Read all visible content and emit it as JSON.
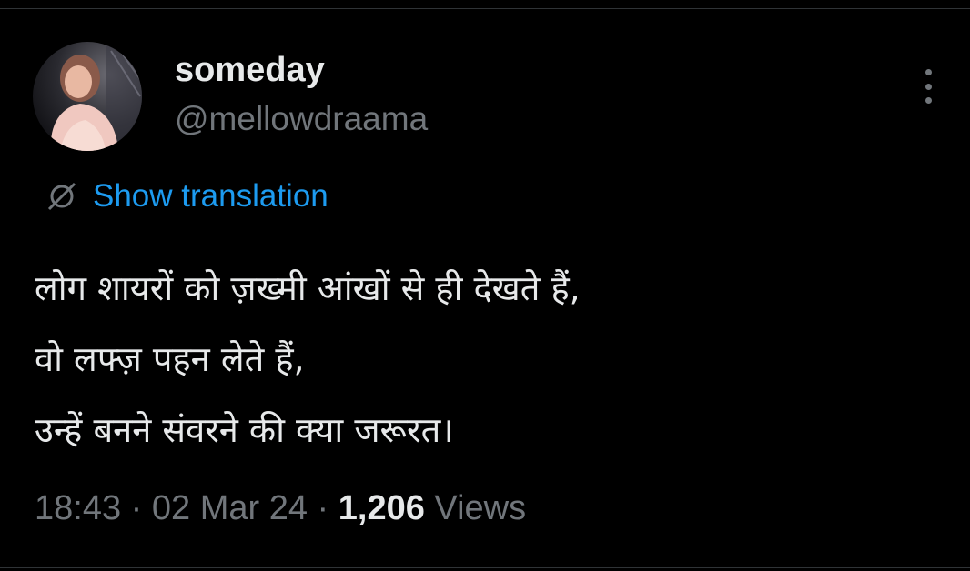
{
  "post": {
    "author": {
      "display_name": "someday",
      "handle": "@mellowdraama",
      "avatar_icon": "profile-photo"
    },
    "menu_icon": "more-vertical-icon",
    "translation": {
      "icon": "globe-icon",
      "label": "Show translation"
    },
    "text_lines": [
      "लोग शायरों को ज़ख्मी आंखों से ही देखते हैं,",
      "वो लफ्ज़ पहन लेते हैं,",
      "उन्हें बनने संवरने की क्या जरूरत।"
    ],
    "meta": {
      "time": "18:43",
      "separator": " · ",
      "date": "02 Mar 24",
      "views_count": "1,206",
      "views_label": "Views"
    }
  },
  "colors": {
    "background": "#000000",
    "primary_text": "#e7e9ea",
    "secondary_text": "#71767b",
    "accent": "#1d9bf0",
    "divider": "#2f3336"
  }
}
